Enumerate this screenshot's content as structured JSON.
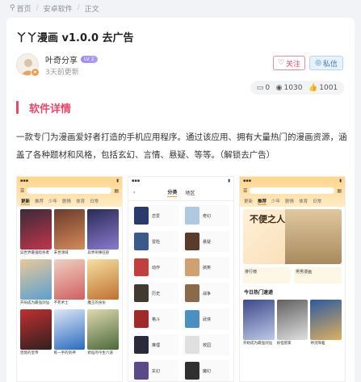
{
  "breadcrumb": {
    "home": "首页",
    "category": "安卓软件",
    "current": "正文"
  },
  "post": {
    "title": "丫丫漫画 v1.0.0 去广告",
    "author": "叶奇分享",
    "level": "LV 2",
    "updated": "3天前更新",
    "follow_label": "关注",
    "message_label": "私信",
    "comments": "0",
    "views": "1030",
    "likes": "1001"
  },
  "section": {
    "title": "软件详情"
  },
  "description": "一款专门为漫画爱好者打造的手机应用程序。通过该应用、拥有大量热门的漫画资源，涵盖了各种题材和风格，包括玄幻、言情、悬疑、等等。（解锁去广告）",
  "screenshots": {
    "shot1": {
      "tabs": [
        "更新",
        "推荐",
        "少年",
        "剧情",
        "体育",
        "日常"
      ],
      "captions": [
        "异世界最强暗杀者",
        "末世领域",
        "异界刑事狂欲",
        "开局成为最强剑仙",
        "不死术士",
        "魔王的身份",
        "昆莫的皇帝",
        "练一手的剑神",
        "修仙的今生六道"
      ]
    },
    "shot2": {
      "tabs": [
        "分类",
        "地区"
      ],
      "items": [
        "恋爱",
        "奇幻",
        "冒险",
        "悬疑",
        "动作",
        "搞笑",
        "历史",
        "战争",
        "格斗",
        "武侠",
        "推理",
        "校园",
        "玄幻",
        "魔幻"
      ]
    },
    "shot3": {
      "tabs": [
        "更新",
        "推荐",
        "少年",
        "剧情",
        "体育",
        "日常"
      ],
      "banner": "不便之人",
      "promo": [
        "排行榜",
        "男男漫画"
      ],
      "hot_title": "今日热门速递",
      "captions": [
        "开始成为最强剑仙",
        "妖怪管家",
        "神灵降临"
      ]
    }
  },
  "colors": {
    "accent": "#e9486b",
    "message": "#3a7fc9",
    "background": "#f2f3f7"
  }
}
